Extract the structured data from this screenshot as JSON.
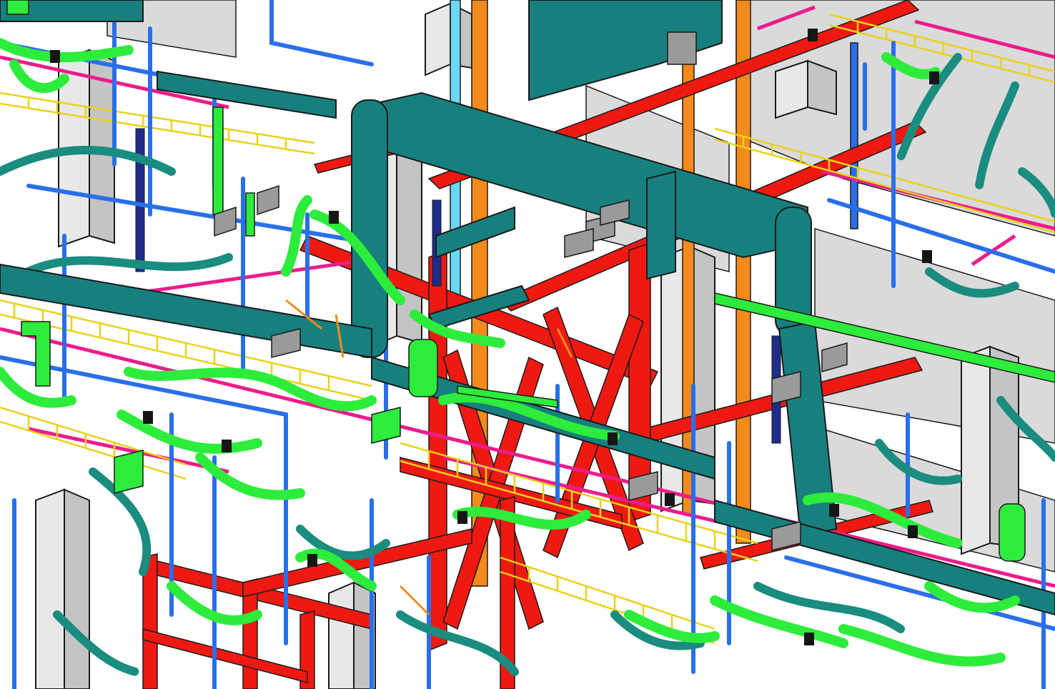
{
  "scene": {
    "kind": "isometric MEP coordination model",
    "layers": {
      "hvac_duct": "#17807e",
      "flex_duct_green": "#2eec3c",
      "flex_duct_teal": "#1a8c80",
      "structural_steel": "#ee1a12",
      "domestic_water": "#2a6fea",
      "fire_line_magenta": "#ec1c8c",
      "cable_tray": "#e8d21a",
      "riser_orange": "#f38a1c",
      "riser_cyan": "#6ad8f4",
      "concrete_column": "#dcdcdc",
      "dark_blue_pipe": "#1e2d8c",
      "damper_grey": "#9a9a9a",
      "coupling_black": "#161616"
    }
  }
}
